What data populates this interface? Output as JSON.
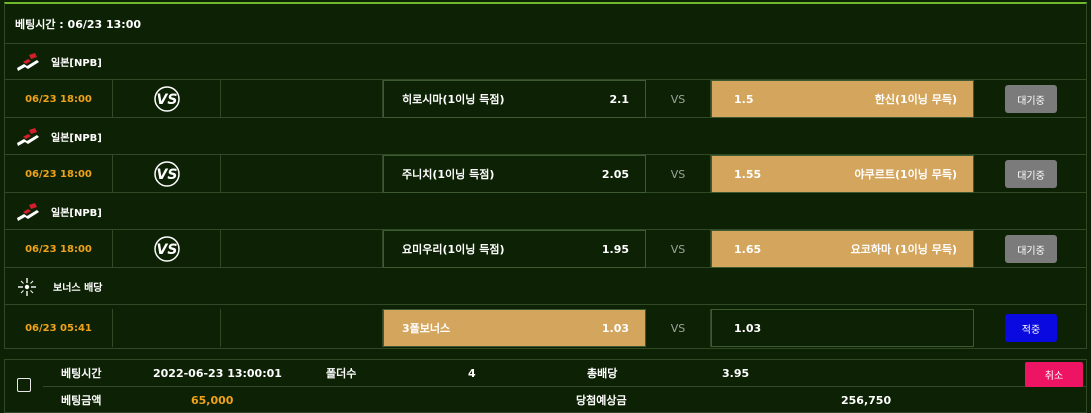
{
  "header": {
    "bet_time": "베팅시간 : 06/23 13:00"
  },
  "leagues": [
    {
      "name": "일본[NPB]",
      "icon": "japan-flag-icon"
    },
    {
      "name": "일본[NPB]",
      "icon": "japan-flag-icon"
    },
    {
      "name": "일본[NPB]",
      "icon": "japan-flag-icon"
    },
    {
      "name": "보너스 배당",
      "icon": "bonus-sparkle-icon"
    }
  ],
  "games": [
    {
      "time": "06/23 18:00",
      "home": "히로시마(1이닝 득점)",
      "home_odds": "2.1",
      "vs": "VS",
      "away_odds": "1.5",
      "away": "한신(1이닝 무득)",
      "status": "대기중",
      "selected": "away"
    },
    {
      "time": "06/23 18:00",
      "home": "주니치(1이닝 득점)",
      "home_odds": "2.05",
      "vs": "VS",
      "away_odds": "1.55",
      "away": "야쿠르트(1이닝 무득)",
      "status": "대기중",
      "selected": "away"
    },
    {
      "time": "06/23 18:00",
      "home": "요미우리(1이닝 득점)",
      "home_odds": "1.95",
      "vs": "VS",
      "away_odds": "1.65",
      "away": "요코하마 (1이닝 무득)",
      "status": "대기중",
      "selected": "away"
    },
    {
      "time": "06/23 05:41",
      "home": "3폴보너스",
      "home_odds": "1.03",
      "vs": "VS",
      "away_odds": "1.03",
      "away": "",
      "status": "적중",
      "selected": "home"
    }
  ],
  "summary": {
    "bet_time_label": "베팅시간",
    "bet_time_value": "2022-06-23 13:00:01",
    "folder_label": "폴더수",
    "folder_value": "4",
    "total_odds_label": "총배당",
    "total_odds_value": "3.95",
    "bet_amount_label": "베팅금액",
    "bet_amount_value": "65,000",
    "expected_label": "당첨예상금",
    "expected_value": "256,750",
    "cancel_label": "취소"
  },
  "colors": {
    "background": "#0d2205",
    "accent_green": "#6fb82e",
    "selected_odds": "#d4a55c",
    "time_orange": "#f0a31a",
    "cancel_pink": "#ee1464",
    "win_blue": "#0a0ae0",
    "wait_gray": "#7b7b7b"
  }
}
